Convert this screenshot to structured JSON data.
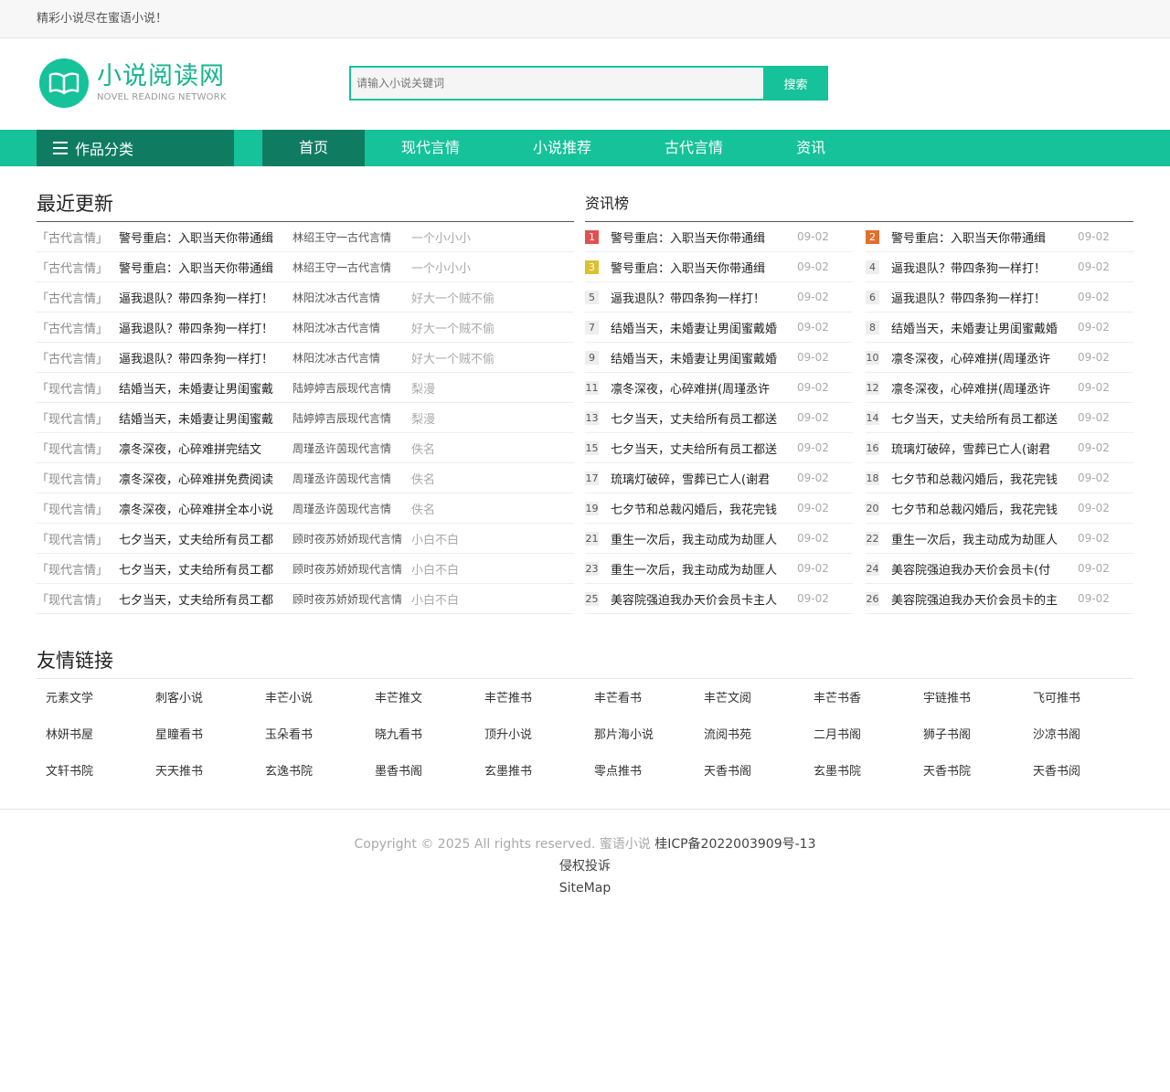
{
  "topbar": {
    "text": "精彩小说尽在蜜语小说！"
  },
  "logo": {
    "title": "小说阅读网",
    "subtitle": "NOVEL READING NETWORK"
  },
  "search": {
    "placeholder": "请输入小说关键词",
    "button": "搜索"
  },
  "nav": {
    "category_label": "作品分类",
    "items": [
      "首页",
      "现代言情",
      "小说推荐",
      "古代言情",
      "资讯"
    ]
  },
  "updates": {
    "title": "最近更新",
    "rows": [
      {
        "cat": "「古代言情」",
        "title": "警号重启：入职当天你带通缉",
        "info": "林绍王守一古代言情",
        "author": "一个小小小"
      },
      {
        "cat": "「古代言情」",
        "title": "警号重启：入职当天你带通缉",
        "info": "林绍王守一古代言情",
        "author": "一个小小小"
      },
      {
        "cat": "「古代言情」",
        "title": "逼我退队？带四条狗一样打！",
        "info": "林阳沈冰古代言情",
        "author": "好大一个贼不偷"
      },
      {
        "cat": "「古代言情」",
        "title": "逼我退队？带四条狗一样打！",
        "info": "林阳沈冰古代言情",
        "author": "好大一个贼不偷"
      },
      {
        "cat": "「古代言情」",
        "title": "逼我退队？带四条狗一样打！",
        "info": "林阳沈冰古代言情",
        "author": "好大一个贼不偷"
      },
      {
        "cat": "「现代言情」",
        "title": "结婚当天，未婚妻让男闺蜜戴",
        "info": "陆婷婷吉辰现代言情",
        "author": "梨漫"
      },
      {
        "cat": "「现代言情」",
        "title": "结婚当天，未婚妻让男闺蜜戴",
        "info": "陆婷婷吉辰现代言情",
        "author": "梨漫"
      },
      {
        "cat": "「现代言情」",
        "title": "凛冬深夜，心碎难拼完结文",
        "info": "周瑾丞许茵现代言情",
        "author": "佚名"
      },
      {
        "cat": "「现代言情」",
        "title": "凛冬深夜，心碎难拼免费阅读",
        "info": "周瑾丞许茵现代言情",
        "author": "佚名"
      },
      {
        "cat": "「现代言情」",
        "title": "凛冬深夜，心碎难拼全本小说",
        "info": "周瑾丞许茵现代言情",
        "author": "佚名"
      },
      {
        "cat": "「现代言情」",
        "title": "七夕当天，丈夫给所有员工都",
        "info": "顾时夜苏娇娇现代言情",
        "author": "小白不白"
      },
      {
        "cat": "「现代言情」",
        "title": "七夕当天，丈夫给所有员工都",
        "info": "顾时夜苏娇娇现代言情",
        "author": "小白不白"
      },
      {
        "cat": "「现代言情」",
        "title": "七夕当天，丈夫给所有员工都",
        "info": "顾时夜苏娇娇现代言情",
        "author": "小白不白"
      }
    ]
  },
  "ranking": {
    "title": "资讯榜",
    "items": [
      {
        "num": "1",
        "name": "警号重启：入职当天你带通缉",
        "date": "09-02"
      },
      {
        "num": "2",
        "name": "警号重启：入职当天你带通缉",
        "date": "09-02"
      },
      {
        "num": "3",
        "name": "警号重启：入职当天你带通缉",
        "date": "09-02"
      },
      {
        "num": "4",
        "name": "逼我退队？带四条狗一样打！",
        "date": "09-02"
      },
      {
        "num": "5",
        "name": "逼我退队？带四条狗一样打！",
        "date": "09-02"
      },
      {
        "num": "6",
        "name": "逼我退队？带四条狗一样打！",
        "date": "09-02"
      },
      {
        "num": "7",
        "name": "结婚当天，未婚妻让男闺蜜戴婚",
        "date": "09-02"
      },
      {
        "num": "8",
        "name": "结婚当天，未婚妻让男闺蜜戴婚",
        "date": "09-02"
      },
      {
        "num": "9",
        "name": "结婚当天，未婚妻让男闺蜜戴婚",
        "date": "09-02"
      },
      {
        "num": "10",
        "name": "凛冬深夜，心碎难拼(周瑾丞许",
        "date": "09-02"
      },
      {
        "num": "11",
        "name": "凛冬深夜，心碎难拼(周瑾丞许",
        "date": "09-02"
      },
      {
        "num": "12",
        "name": "凛冬深夜，心碎难拼(周瑾丞许",
        "date": "09-02"
      },
      {
        "num": "13",
        "name": "七夕当天，丈夫给所有员工都送",
        "date": "09-02"
      },
      {
        "num": "14",
        "name": "七夕当天，丈夫给所有员工都送",
        "date": "09-02"
      },
      {
        "num": "15",
        "name": "七夕当天，丈夫给所有员工都送",
        "date": "09-02"
      },
      {
        "num": "16",
        "name": "琉璃灯破碎，雪葬已亡人(谢君",
        "date": "09-02"
      },
      {
        "num": "17",
        "name": "琉璃灯破碎，雪葬已亡人(谢君",
        "date": "09-02"
      },
      {
        "num": "18",
        "name": "七夕节和总裁闪婚后，我花完钱",
        "date": "09-02"
      },
      {
        "num": "19",
        "name": "七夕节和总裁闪婚后，我花完钱",
        "date": "09-02"
      },
      {
        "num": "20",
        "name": "七夕节和总裁闪婚后，我花完钱",
        "date": "09-02"
      },
      {
        "num": "21",
        "name": "重生一次后，我主动成为劫匪人",
        "date": "09-02"
      },
      {
        "num": "22",
        "name": "重生一次后，我主动成为劫匪人",
        "date": "09-02"
      },
      {
        "num": "23",
        "name": "重生一次后，我主动成为劫匪人",
        "date": "09-02"
      },
      {
        "num": "24",
        "name": "美容院强迫我办天价会员卡(付",
        "date": "09-02"
      },
      {
        "num": "25",
        "name": "美容院强迫我办天价会员卡主人",
        "date": "09-02"
      },
      {
        "num": "26",
        "name": "美容院强迫我办天价会员卡的主",
        "date": "09-02"
      }
    ]
  },
  "friends": {
    "title": "友情链接",
    "links": [
      "元素文学",
      "刺客小说",
      "丰芒小说",
      "丰芒推文",
      "丰芒推书",
      "丰芒看书",
      "丰芒文阅",
      "丰芒书香",
      "宇链推书",
      "飞可推书",
      "林妍书屋",
      "星瞳看书",
      "玉朵看书",
      "晓九看书",
      "顶升小说",
      "那片海小说",
      "流阅书苑",
      "二月书阁",
      "狮子书阁",
      "沙凉书阁",
      "文轩书院",
      "天天推书",
      "玄逸书院",
      "墨香书阁",
      "玄墨推书",
      "零点推书",
      "天香书阁",
      "玄墨书院",
      "天香书院",
      "天香书阅"
    ]
  },
  "footer": {
    "copyright": "Copyright © 2025 All rights reserved. 蜜语小说",
    "icp": "桂ICP备2022003909号-13",
    "complaint": "侵权投诉",
    "sitemap": "SiteMap"
  },
  "colors": {
    "accent": "#16c29a",
    "accent_dark": "#0f7c62",
    "rank1": "#e05050",
    "rank2": "#e0702e",
    "rank3": "#ddc030"
  }
}
